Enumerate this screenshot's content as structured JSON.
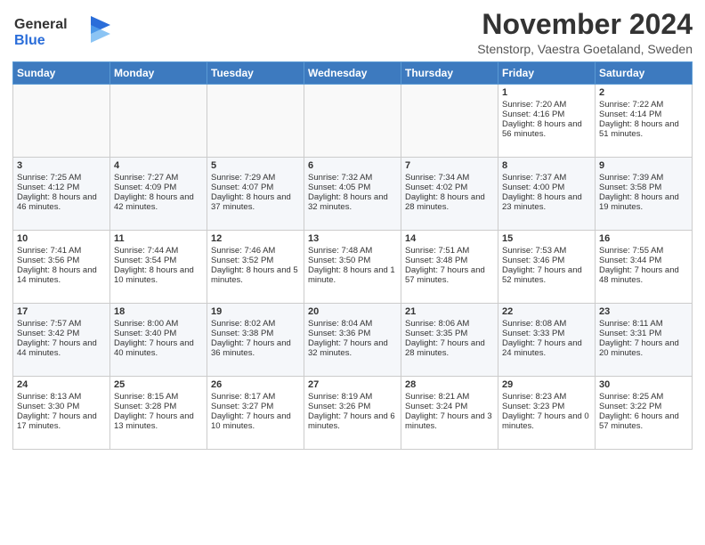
{
  "header": {
    "logo_line1": "General",
    "logo_line2": "Blue",
    "month_title": "November 2024",
    "location": "Stenstorp, Vaestra Goetaland, Sweden"
  },
  "days_of_week": [
    "Sunday",
    "Monday",
    "Tuesday",
    "Wednesday",
    "Thursday",
    "Friday",
    "Saturday"
  ],
  "weeks": [
    [
      {
        "day": "",
        "content": ""
      },
      {
        "day": "",
        "content": ""
      },
      {
        "day": "",
        "content": ""
      },
      {
        "day": "",
        "content": ""
      },
      {
        "day": "",
        "content": ""
      },
      {
        "day": "1",
        "content": "Sunrise: 7:20 AM\nSunset: 4:16 PM\nDaylight: 8 hours and 56 minutes."
      },
      {
        "day": "2",
        "content": "Sunrise: 7:22 AM\nSunset: 4:14 PM\nDaylight: 8 hours and 51 minutes."
      }
    ],
    [
      {
        "day": "3",
        "content": "Sunrise: 7:25 AM\nSunset: 4:12 PM\nDaylight: 8 hours and 46 minutes."
      },
      {
        "day": "4",
        "content": "Sunrise: 7:27 AM\nSunset: 4:09 PM\nDaylight: 8 hours and 42 minutes."
      },
      {
        "day": "5",
        "content": "Sunrise: 7:29 AM\nSunset: 4:07 PM\nDaylight: 8 hours and 37 minutes."
      },
      {
        "day": "6",
        "content": "Sunrise: 7:32 AM\nSunset: 4:05 PM\nDaylight: 8 hours and 32 minutes."
      },
      {
        "day": "7",
        "content": "Sunrise: 7:34 AM\nSunset: 4:02 PM\nDaylight: 8 hours and 28 minutes."
      },
      {
        "day": "8",
        "content": "Sunrise: 7:37 AM\nSunset: 4:00 PM\nDaylight: 8 hours and 23 minutes."
      },
      {
        "day": "9",
        "content": "Sunrise: 7:39 AM\nSunset: 3:58 PM\nDaylight: 8 hours and 19 minutes."
      }
    ],
    [
      {
        "day": "10",
        "content": "Sunrise: 7:41 AM\nSunset: 3:56 PM\nDaylight: 8 hours and 14 minutes."
      },
      {
        "day": "11",
        "content": "Sunrise: 7:44 AM\nSunset: 3:54 PM\nDaylight: 8 hours and 10 minutes."
      },
      {
        "day": "12",
        "content": "Sunrise: 7:46 AM\nSunset: 3:52 PM\nDaylight: 8 hours and 5 minutes."
      },
      {
        "day": "13",
        "content": "Sunrise: 7:48 AM\nSunset: 3:50 PM\nDaylight: 8 hours and 1 minute."
      },
      {
        "day": "14",
        "content": "Sunrise: 7:51 AM\nSunset: 3:48 PM\nDaylight: 7 hours and 57 minutes."
      },
      {
        "day": "15",
        "content": "Sunrise: 7:53 AM\nSunset: 3:46 PM\nDaylight: 7 hours and 52 minutes."
      },
      {
        "day": "16",
        "content": "Sunrise: 7:55 AM\nSunset: 3:44 PM\nDaylight: 7 hours and 48 minutes."
      }
    ],
    [
      {
        "day": "17",
        "content": "Sunrise: 7:57 AM\nSunset: 3:42 PM\nDaylight: 7 hours and 44 minutes."
      },
      {
        "day": "18",
        "content": "Sunrise: 8:00 AM\nSunset: 3:40 PM\nDaylight: 7 hours and 40 minutes."
      },
      {
        "day": "19",
        "content": "Sunrise: 8:02 AM\nSunset: 3:38 PM\nDaylight: 7 hours and 36 minutes."
      },
      {
        "day": "20",
        "content": "Sunrise: 8:04 AM\nSunset: 3:36 PM\nDaylight: 7 hours and 32 minutes."
      },
      {
        "day": "21",
        "content": "Sunrise: 8:06 AM\nSunset: 3:35 PM\nDaylight: 7 hours and 28 minutes."
      },
      {
        "day": "22",
        "content": "Sunrise: 8:08 AM\nSunset: 3:33 PM\nDaylight: 7 hours and 24 minutes."
      },
      {
        "day": "23",
        "content": "Sunrise: 8:11 AM\nSunset: 3:31 PM\nDaylight: 7 hours and 20 minutes."
      }
    ],
    [
      {
        "day": "24",
        "content": "Sunrise: 8:13 AM\nSunset: 3:30 PM\nDaylight: 7 hours and 17 minutes."
      },
      {
        "day": "25",
        "content": "Sunrise: 8:15 AM\nSunset: 3:28 PM\nDaylight: 7 hours and 13 minutes."
      },
      {
        "day": "26",
        "content": "Sunrise: 8:17 AM\nSunset: 3:27 PM\nDaylight: 7 hours and 10 minutes."
      },
      {
        "day": "27",
        "content": "Sunrise: 8:19 AM\nSunset: 3:26 PM\nDaylight: 7 hours and 6 minutes."
      },
      {
        "day": "28",
        "content": "Sunrise: 8:21 AM\nSunset: 3:24 PM\nDaylight: 7 hours and 3 minutes."
      },
      {
        "day": "29",
        "content": "Sunrise: 8:23 AM\nSunset: 3:23 PM\nDaylight: 7 hours and 0 minutes."
      },
      {
        "day": "30",
        "content": "Sunrise: 8:25 AM\nSunset: 3:22 PM\nDaylight: 6 hours and 57 minutes."
      }
    ]
  ]
}
